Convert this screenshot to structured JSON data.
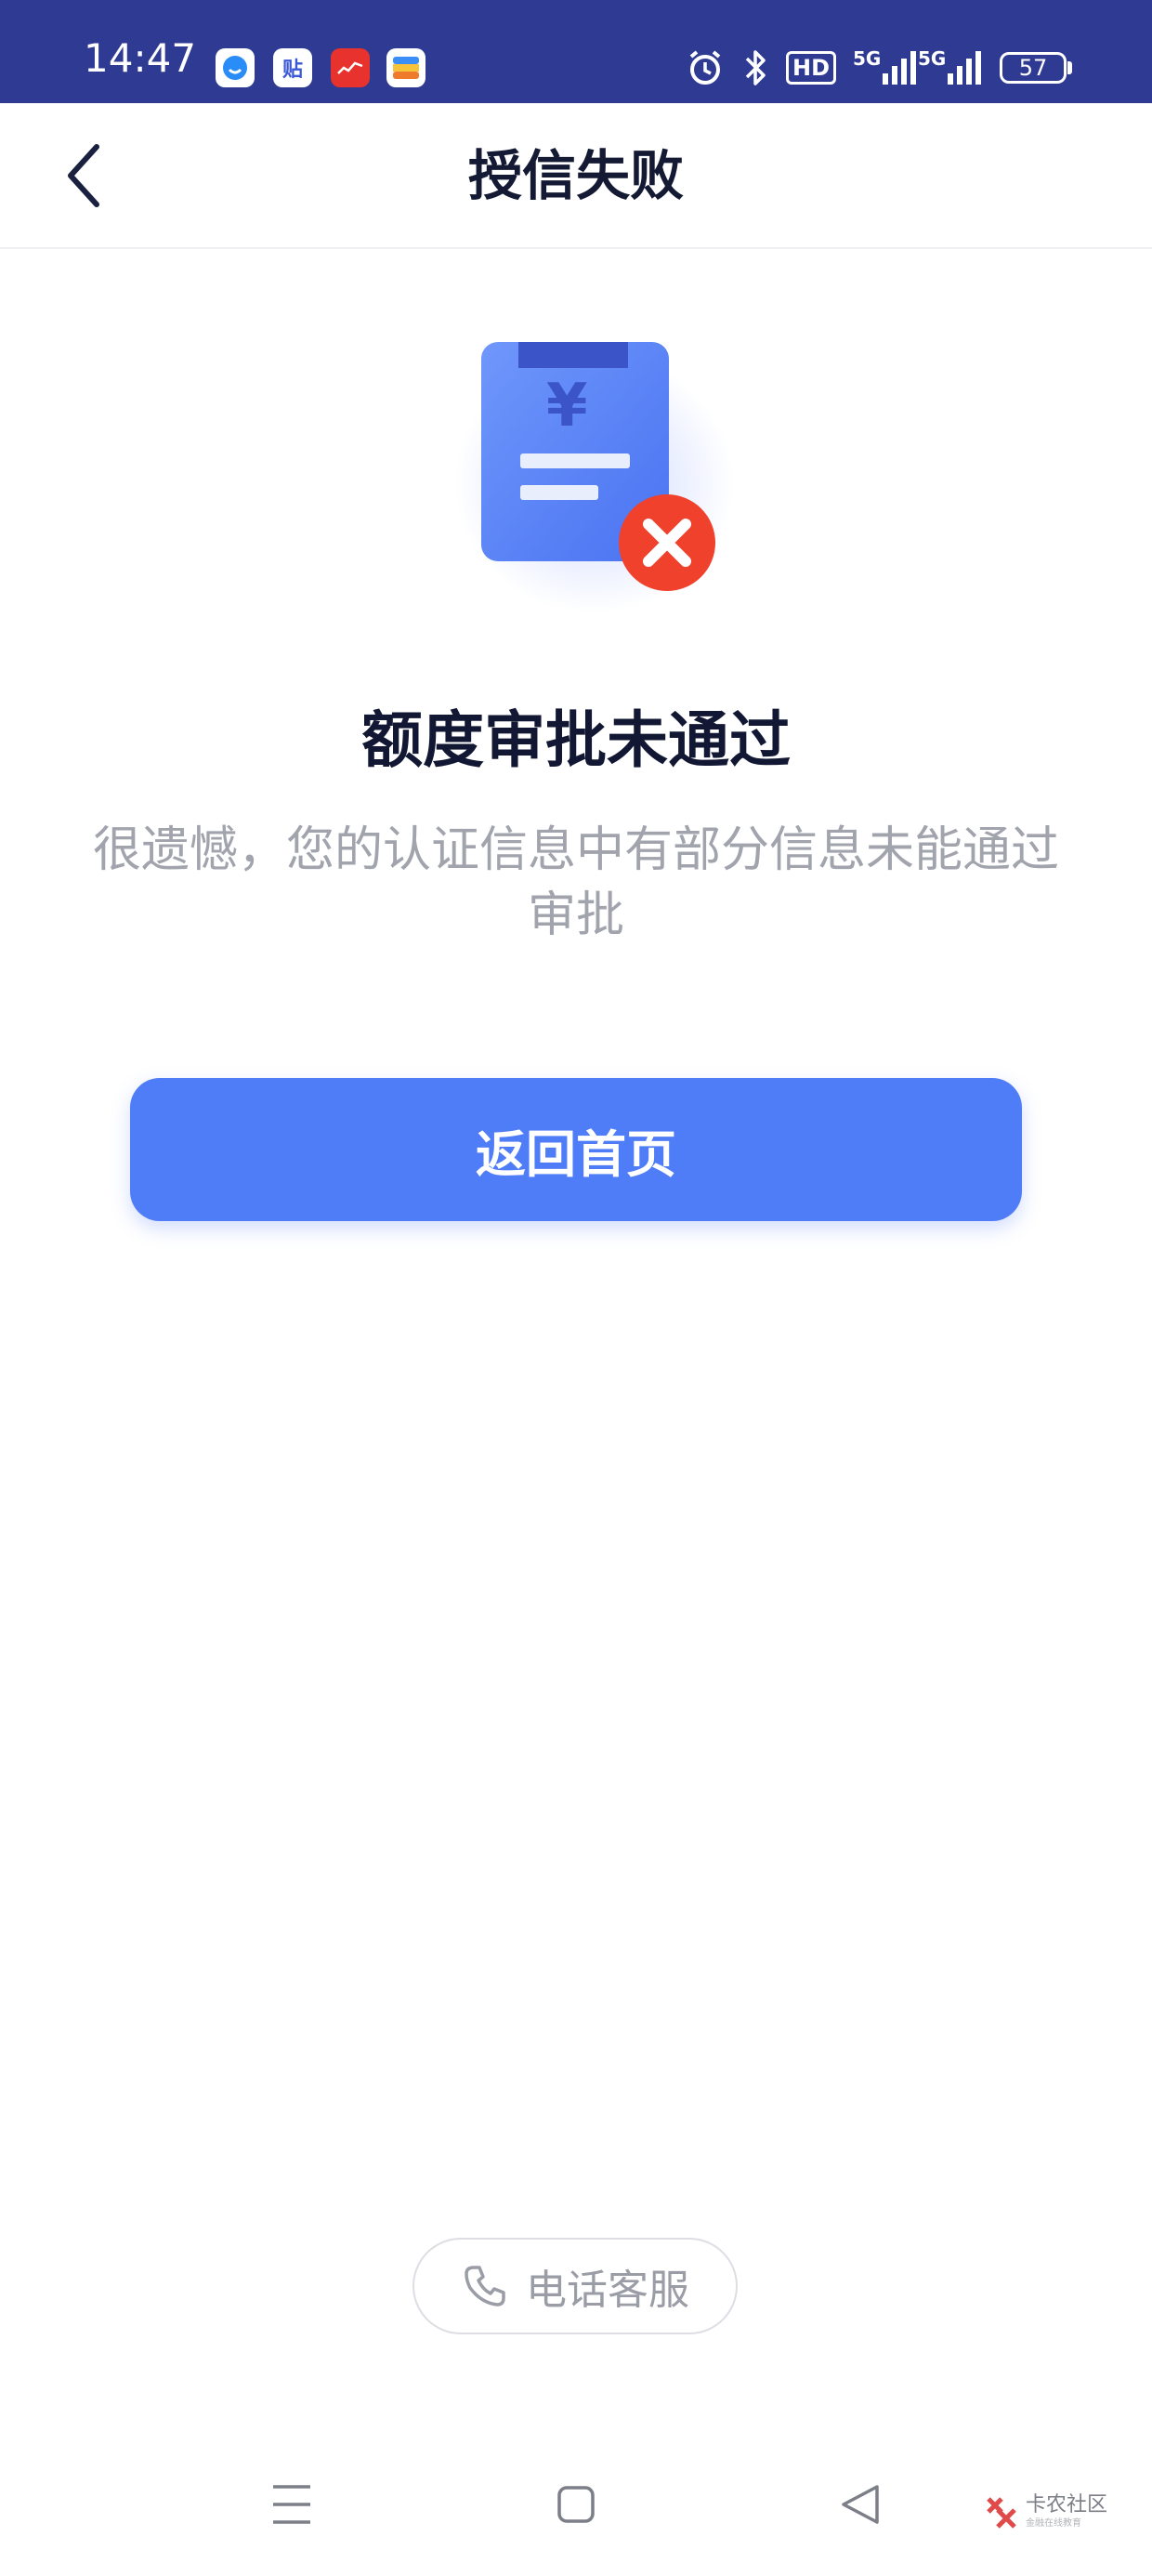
{
  "status_bar": {
    "time": "14:47",
    "apps": [
      {
        "icon": "chat-app-icon",
        "glyph": "",
        "bg": "#ffffff",
        "fg": "#2a8cf7"
      },
      {
        "icon": "tieba-app-icon",
        "glyph": "贴",
        "bg": "#ffffff",
        "fg": "#3b59d6"
      },
      {
        "icon": "red-app-icon",
        "glyph": "",
        "bg": "#e8322d",
        "fg": "#ffffff"
      },
      {
        "icon": "wallet-app-icon",
        "glyph": "",
        "bg": "#ffffff",
        "fg": "#f2a91c"
      }
    ],
    "hd_label": "HD",
    "network_1": "5G",
    "network_2": "5G",
    "battery": "57"
  },
  "nav": {
    "title": "授信失败"
  },
  "result": {
    "title": "额度审批未通过",
    "description": "很遗憾，您的认证信息中有部分信息未能通过审批"
  },
  "actions": {
    "home_label": "返回首页",
    "service_label": "电话客服"
  },
  "watermark": {
    "main": "卡农社区",
    "sub": "金融在线教育"
  },
  "colors": {
    "status_bar": "#2f3a93",
    "primary": "#4f7cf7",
    "error": "#f0412d"
  }
}
